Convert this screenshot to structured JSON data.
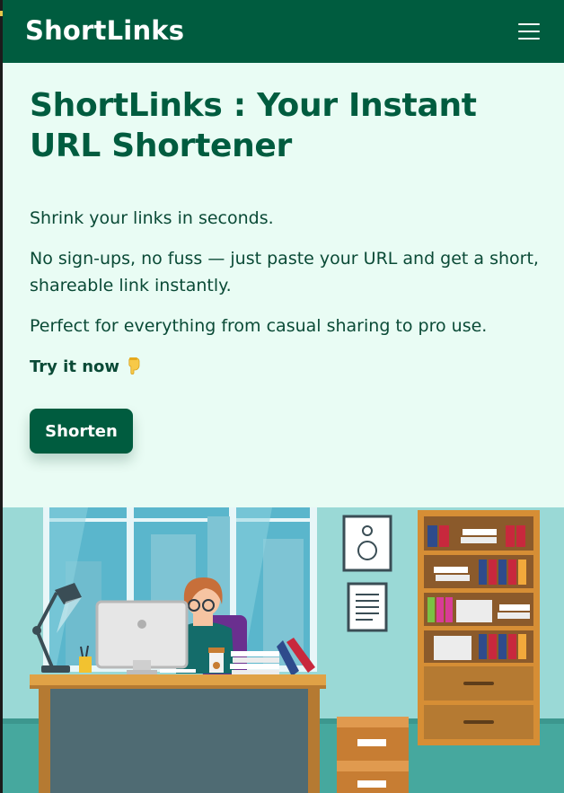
{
  "navbar": {
    "brand": "ShortLinks",
    "menu_icon": "hamburger-menu-icon"
  },
  "hero": {
    "title": "ShortLinks : Your Instant URL Shortener",
    "paragraphs": [
      "Shrink your links in seconds.",
      "No sign-ups, no fuss — just paste your URL and get a short, shareable link instantly.",
      "Perfect for everything from casual sharing to pro use."
    ],
    "cta_text": "Try it now",
    "cta_icon": "pointing-down-hand-icon",
    "button_label": "Shorten"
  },
  "illustration": {
    "name": "office-worker-illustration"
  },
  "colors": {
    "primary": "#005c3f",
    "page_background": "#e9fcf4",
    "text": "#0a4a36"
  }
}
